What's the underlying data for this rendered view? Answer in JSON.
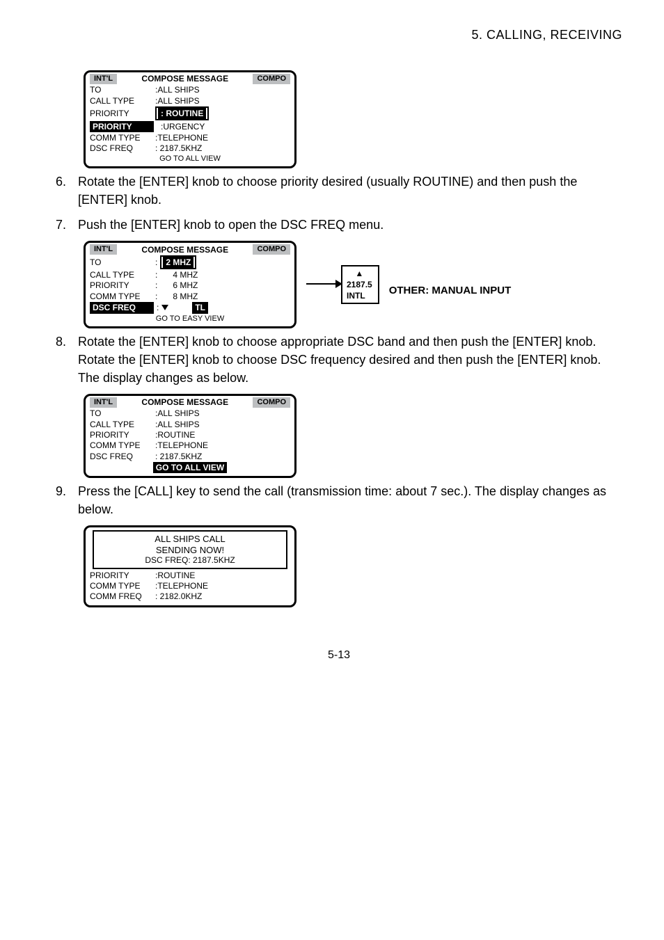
{
  "header": "5.  CALLING,  RECEIVING",
  "screen1": {
    "left_tab": "INT'L",
    "right_tab": "COMPO",
    "to_label": "TO",
    "to_value": ":ALL SHIPS",
    "calltype_label": "CALL TYPE",
    "calltype_value": ":ALL SHIPS",
    "priority_label": "PRIORITY",
    "priority_value": ": ROUTINE",
    "commtype_label": "COMM TYPE",
    "commtype_value": ":TELEPHONE",
    "dsc_label": "DSC FREQ",
    "dsc_value": ":   2187.5KHZ",
    "goto_label": "GO TO ALL VIEW"
  },
  "step6": "Rotate the [ENTER] knob to choose priority desired (usually ROUTINE) and then push the [ENTER] knob.",
  "step7": "Push the [ENTER] knob to open the DSC FREQ menu.",
  "screen2": {
    "left_tab": "INT'L",
    "right_tab": "COMPO",
    "to_label": "TO",
    "to_value": ":",
    "to_hl": "2 MHZ",
    "calltype_label": "CALL TYPE",
    "calltype_value": ":",
    "calltype_after": "4 MHZ",
    "prio_label": "PRIORITY",
    "prio_value": ":",
    "prio_after": "6 MHZ",
    "comm_label": "COMM TYPE",
    "comm_value": ":",
    "comm_after": "8 MHZ",
    "dsc_label": "DSC FREQ",
    "dsc_value": ":",
    "tl": "TL",
    "go_label": "GO TO EASY VIEW",
    "freq_items": [
      "▲",
      "2187.5",
      "INTL"
    ],
    "other": "OTHER: MANUAL INPUT"
  },
  "step8": "Rotate the [ENTER] knob to choose appropriate DSC band and then push the [ENTER] knob. Rotate the [ENTER] knob to choose DSC frequency desired and then push the [ENTER] knob. The display changes as below.",
  "screen3": {
    "left_tab": "INT'L",
    "right_tab": "COMPO",
    "to_label": "TO",
    "to_value": ":ALL SHIPS",
    "call_label": "CALL TYPE",
    "call_value": ":ALL SHIPS",
    "prio_label": "PRIORITY",
    "prio_value": ":ROUTINE",
    "comm_label": "COMM TYPE",
    "comm_value": ":TELEPHONE",
    "dsc_label": "DSC FREQ",
    "dsc_value": ":   2187.5KHZ",
    "goto_label": "GO TO ALL VIEW"
  },
  "step9": "Press the [CALL] key to send the call (transmission time: about 7 sec.). The display changes as below.",
  "screen4": {
    "line1": "ALL SHIPS CALL",
    "line2": "SENDING NOW!",
    "line3": "DSC FREQ:  2187.5KHZ",
    "prio_label": "PRIORITY",
    "prio_value": ":ROUTINE",
    "comm_label": "COMM TYPE",
    "comm_value": ":TELEPHONE",
    "comm_freq_label": "COMM FREQ",
    "comm_freq_value": ":   2182.0KHZ"
  },
  "page": "5-13"
}
